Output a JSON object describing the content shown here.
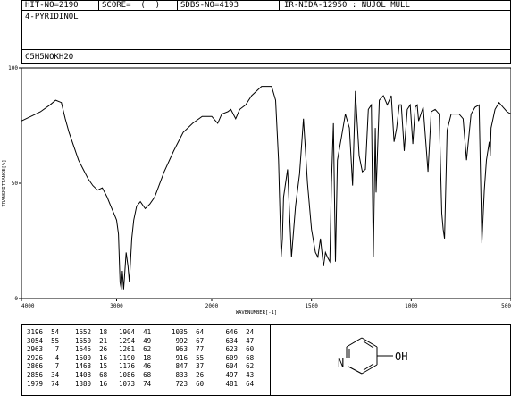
{
  "header": {
    "hit_no": "HIT-NO=2190",
    "score": "SCORE=  (  )",
    "sdbs_no": "SDBS-NO=4193",
    "ir_info": "IR-NIDA-12950 : NUJOL MULL",
    "compound_name": "4-PYRIDINOL",
    "formula": "C5H5NOKH2O"
  },
  "chart_data": {
    "type": "line",
    "xlabel": "WAVENUMBER[-1]",
    "ylabel": "TRANSMITTANCE[%]",
    "x_range": [
      4000,
      500
    ],
    "y_range": [
      0,
      100
    ],
    "x_ticks": [
      "4000",
      "3000",
      "2000",
      "1500",
      "1000",
      "500"
    ],
    "y_ticks": [
      "100",
      "50",
      "0"
    ],
    "grid": false,
    "series": [
      {
        "points": [
          [
            4000,
            77
          ],
          [
            3900,
            79
          ],
          [
            3800,
            81
          ],
          [
            3700,
            84
          ],
          [
            3640,
            86
          ],
          [
            3580,
            85
          ],
          [
            3540,
            78
          ],
          [
            3500,
            72
          ],
          [
            3450,
            66
          ],
          [
            3400,
            60
          ],
          [
            3350,
            56
          ],
          [
            3300,
            52
          ],
          [
            3250,
            49
          ],
          [
            3200,
            47
          ],
          [
            3150,
            48
          ],
          [
            3100,
            44
          ],
          [
            3060,
            40
          ],
          [
            3020,
            36
          ],
          [
            3000,
            34
          ],
          [
            2980,
            28
          ],
          [
            2963,
            7
          ],
          [
            2950,
            4
          ],
          [
            2940,
            12
          ],
          [
            2926,
            4
          ],
          [
            2900,
            20
          ],
          [
            2880,
            14
          ],
          [
            2866,
            7
          ],
          [
            2840,
            26
          ],
          [
            2820,
            34
          ],
          [
            2790,
            40
          ],
          [
            2750,
            42
          ],
          [
            2700,
            39
          ],
          [
            2650,
            41
          ],
          [
            2600,
            44
          ],
          [
            2500,
            55
          ],
          [
            2400,
            64
          ],
          [
            2300,
            72
          ],
          [
            2200,
            76
          ],
          [
            2100,
            79
          ],
          [
            2000,
            79
          ],
          [
            1970,
            76
          ],
          [
            1950,
            80
          ],
          [
            1920,
            81
          ],
          [
            1904,
            82
          ],
          [
            1880,
            78
          ],
          [
            1860,
            82
          ],
          [
            1830,
            84
          ],
          [
            1800,
            88
          ],
          [
            1750,
            92
          ],
          [
            1700,
            92
          ],
          [
            1680,
            86
          ],
          [
            1665,
            60
          ],
          [
            1652,
            18
          ],
          [
            1646,
            26
          ],
          [
            1640,
            44
          ],
          [
            1620,
            56
          ],
          [
            1600,
            18
          ],
          [
            1580,
            40
          ],
          [
            1560,
            54
          ],
          [
            1540,
            78
          ],
          [
            1520,
            50
          ],
          [
            1500,
            30
          ],
          [
            1480,
            20
          ],
          [
            1468,
            18
          ],
          [
            1455,
            26
          ],
          [
            1440,
            14
          ],
          [
            1430,
            20
          ],
          [
            1420,
            18
          ],
          [
            1408,
            16
          ],
          [
            1400,
            50
          ],
          [
            1390,
            76
          ],
          [
            1380,
            16
          ],
          [
            1370,
            60
          ],
          [
            1350,
            70
          ],
          [
            1330,
            80
          ],
          [
            1310,
            74
          ],
          [
            1294,
            49
          ],
          [
            1280,
            90
          ],
          [
            1261,
            62
          ],
          [
            1245,
            55
          ],
          [
            1230,
            56
          ],
          [
            1215,
            82
          ],
          [
            1200,
            84
          ],
          [
            1190,
            18
          ],
          [
            1180,
            74
          ],
          [
            1176,
            46
          ],
          [
            1160,
            86
          ],
          [
            1140,
            88
          ],
          [
            1120,
            84
          ],
          [
            1100,
            88
          ],
          [
            1086,
            68
          ],
          [
            1073,
            74
          ],
          [
            1060,
            84
          ],
          [
            1050,
            84
          ],
          [
            1035,
            64
          ],
          [
            1020,
            82
          ],
          [
            1005,
            84
          ],
          [
            992,
            67
          ],
          [
            980,
            83
          ],
          [
            970,
            84
          ],
          [
            963,
            77
          ],
          [
            940,
            83
          ],
          [
            916,
            55
          ],
          [
            900,
            81
          ],
          [
            880,
            82
          ],
          [
            860,
            80
          ],
          [
            847,
            37
          ],
          [
            840,
            30
          ],
          [
            833,
            26
          ],
          [
            820,
            73
          ],
          [
            800,
            80
          ],
          [
            780,
            80
          ],
          [
            760,
            80
          ],
          [
            740,
            78
          ],
          [
            723,
            60
          ],
          [
            700,
            80
          ],
          [
            680,
            83
          ],
          [
            660,
            84
          ],
          [
            646,
            24
          ],
          [
            634,
            47
          ],
          [
            623,
            60
          ],
          [
            609,
            68
          ],
          [
            604,
            62
          ],
          [
            600,
            74
          ],
          [
            580,
            82
          ],
          [
            560,
            85
          ],
          [
            540,
            83
          ],
          [
            520,
            81
          ],
          [
            500,
            80
          ]
        ]
      }
    ]
  },
  "peak_table": {
    "columns": [
      [
        "3196  54",
        "3054  55",
        "2963   7",
        "2926   4",
        "2866   7",
        "2856  34",
        "1979  74"
      ],
      [
        "1652  18",
        "1650  21",
        "1646  26",
        "1600  16",
        "1468  15",
        "1408  68",
        "1380  16"
      ],
      [
        "1904  41",
        "1294  49",
        "1261  62",
        "1190  18",
        "1176  46",
        "1086  68",
        "1073  74"
      ],
      [
        "1035  64",
        " 992  67",
        " 963  77",
        " 916  55",
        " 847  37",
        " 833  26",
        " 723  60"
      ],
      [
        " 646  24",
        " 634  47",
        " 623  60",
        " 609  68",
        " 604  62",
        " 497  43",
        " 481  64"
      ]
    ]
  },
  "structure": {
    "atom_n": "N",
    "group": "OH"
  }
}
